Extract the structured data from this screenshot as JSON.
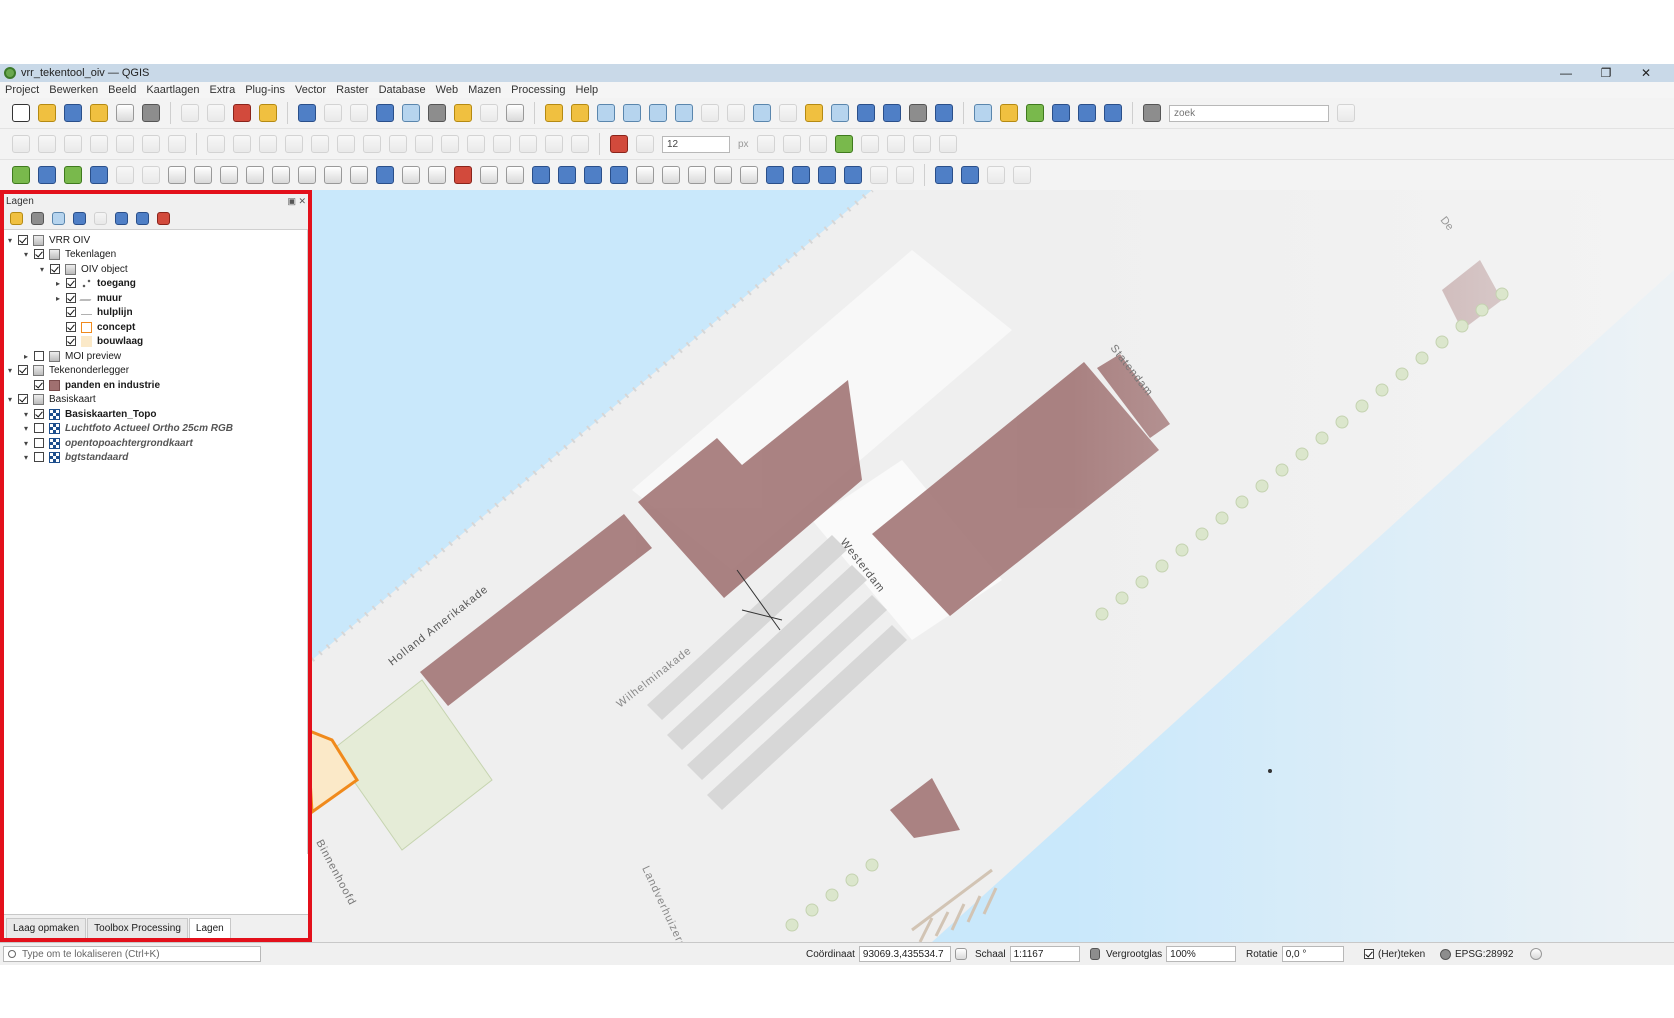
{
  "window": {
    "title": "vrr_tekentool_oiv — QGIS",
    "minimize": "—",
    "maximize": "❐",
    "close": "✕"
  },
  "menu": [
    "Project",
    "Bewerken",
    "Beeld",
    "Kaartlagen",
    "Extra",
    "Plug-ins",
    "Vector",
    "Raster",
    "Database",
    "Web",
    "Mazen",
    "Processing",
    "Help"
  ],
  "toolbar": {
    "search_placeholder": "zoek",
    "size_value": "12",
    "size_unit": "px"
  },
  "layers_panel": {
    "title": "Lagen",
    "rows": [
      {
        "label": "VRR OIV"
      },
      {
        "label": "Tekenlagen"
      },
      {
        "label": "OIV object"
      },
      {
        "label": "toegang"
      },
      {
        "label": "muur"
      },
      {
        "label": "hulplijn"
      },
      {
        "label": "concept"
      },
      {
        "label": "bouwlaag"
      },
      {
        "label": "MOI preview"
      },
      {
        "label": "Tekenonderlegger"
      },
      {
        "label": "panden en industrie"
      },
      {
        "label": "Basiskaart"
      },
      {
        "label": "Basiskaarten_Topo"
      },
      {
        "label": "Luchtfoto Actueel Ortho 25cm RGB"
      },
      {
        "label": "opentopoachtergrondkaart"
      },
      {
        "label": "bgtstandaard"
      }
    ],
    "tabs": [
      "Laag opmaken",
      "Toolbox Processing",
      "Lagen"
    ]
  },
  "map": {
    "labels": {
      "holland": "Holland Amerikakade",
      "wilhelmina": "Wilhelminakade",
      "westerdam": "Westerdam",
      "statendam": "Statendam",
      "landverhuizers": "Landverhuizers",
      "binnenhoofd": "Binnenhoofd",
      "dek": "De"
    }
  },
  "status": {
    "locator_placeholder": "Type om te lokaliseren (Ctrl+K)",
    "coord_label": "Coördinaat",
    "coord_value": "93069.3,435534.7",
    "scale_label": "Schaal",
    "scale_value": "1:1167",
    "magnifier_label": "Vergrootglas",
    "magnifier_value": "100%",
    "rotation_label": "Rotatie",
    "rotation_value": "0,0 °",
    "render_label": "(Her)teken",
    "crs": "EPSG:28992"
  },
  "colors": {
    "highlight": "#e3101b",
    "water": "#c9e8fb",
    "building": "#a47878"
  }
}
